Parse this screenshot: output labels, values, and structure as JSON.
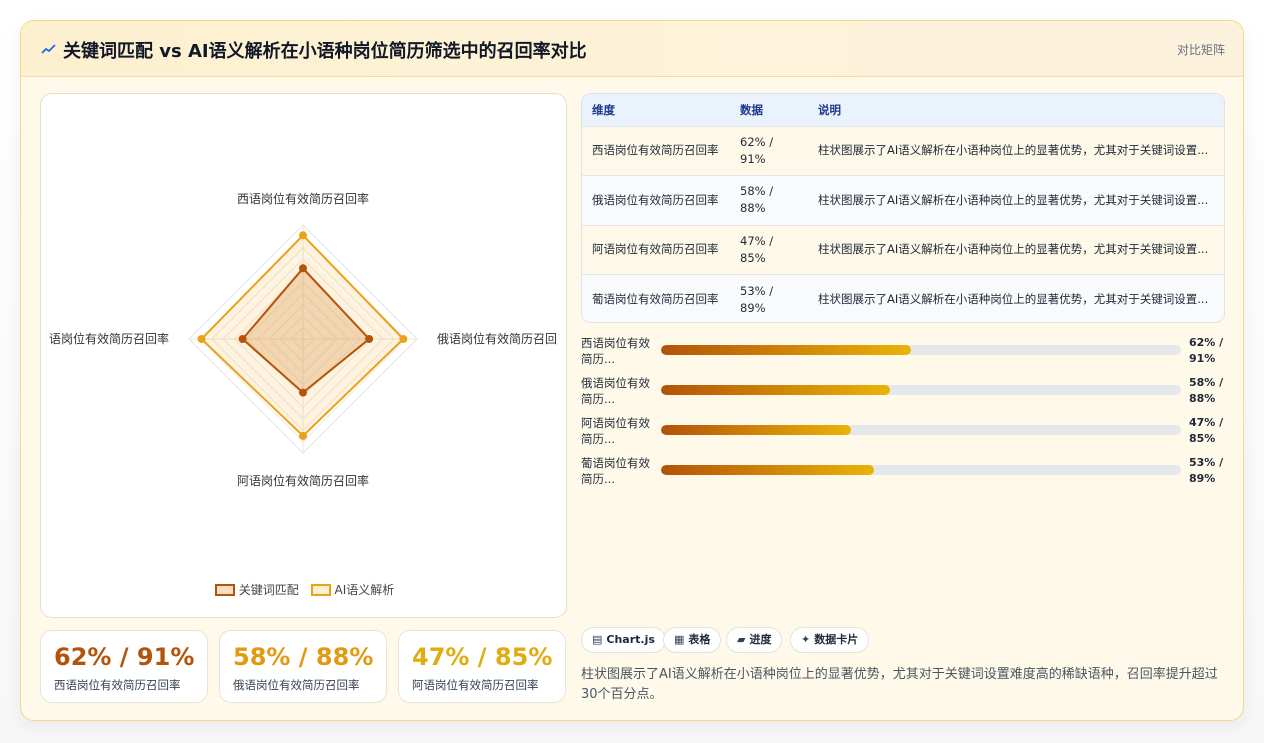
{
  "header": {
    "icon": "chart-line-icon",
    "title": "关键词匹配 vs AI语义解析在小语种岗位简历筛选中的召回率对比",
    "tag": "对比矩阵"
  },
  "colors": {
    "series1": "#b45309",
    "series2": "#e9a21a",
    "gradient_start": "#b45309",
    "gradient_end": "#eab308"
  },
  "chart_data": {
    "type": "radar",
    "categories": [
      "西语岗位有效简历召回率",
      "俄语岗位有效简历召回",
      "阿语岗位有效简历召回率",
      "语岗位有效简历召回率"
    ],
    "series": [
      {
        "name": "关键词匹配",
        "values": [
          62,
          58,
          47,
          53
        ]
      },
      {
        "name": "AI语义解析",
        "values": [
          91,
          88,
          85,
          89
        ]
      }
    ],
    "range": [
      0,
      100
    ],
    "legend": "bottom"
  },
  "stats": [
    {
      "value": "62% / 91%",
      "label": "西语岗位有效简历召回率",
      "color": "#b45309"
    },
    {
      "value": "58% / 88%",
      "label": "俄语岗位有效简历召回率",
      "color": "#e39a12"
    },
    {
      "value": "47% / 85%",
      "label": "阿语岗位有效简历召回率",
      "color": "#e0ac12"
    }
  ],
  "table": {
    "headers": [
      "维度",
      "数据",
      "说明"
    ],
    "rows": [
      {
        "dim": "西语岗位有效简历召回率",
        "data": "62% / 91%",
        "desc": "柱状图展示了AI语义解析在小语种岗位上的显著优势，尤其对于关键词设置..."
      },
      {
        "dim": "俄语岗位有效简历召回率",
        "data": "58% / 88%",
        "desc": "柱状图展示了AI语义解析在小语种岗位上的显著优势，尤其对于关键词设置..."
      },
      {
        "dim": "阿语岗位有效简历召回率",
        "data": "47% / 85%",
        "desc": "柱状图展示了AI语义解析在小语种岗位上的显著优势，尤其对于关键词设置..."
      },
      {
        "dim": "葡语岗位有效简历召回率",
        "data": "53% / 89%",
        "desc": "柱状图展示了AI语义解析在小语种岗位上的显著优势，尤其对于关键词设置..."
      }
    ]
  },
  "progress": [
    {
      "label": "西语岗位有效简历...",
      "value": "62% / 91%",
      "fill": 0.48
    },
    {
      "label": "俄语岗位有效简历...",
      "value": "58% / 88%",
      "fill": 0.44
    },
    {
      "label": "阿语岗位有效简历...",
      "value": "47% / 85%",
      "fill": 0.365
    },
    {
      "label": "葡语岗位有效简历...",
      "value": "53% / 89%",
      "fill": 0.41
    }
  ],
  "chips": [
    {
      "icon": "chart-icon",
      "glyph": "▤",
      "label": "Chart.js"
    },
    {
      "icon": "table-icon",
      "glyph": "▦",
      "label": "表格"
    },
    {
      "icon": "progress-icon",
      "glyph": "▰",
      "label": "进度"
    },
    {
      "icon": "card-icon",
      "glyph": "✦",
      "label": "数据卡片"
    }
  ],
  "summary": "柱状图展示了AI语义解析在小语种岗位上的显著优势，尤其对于关键词设置难度高的稀缺语种，召回率提升超过30个百分点。"
}
